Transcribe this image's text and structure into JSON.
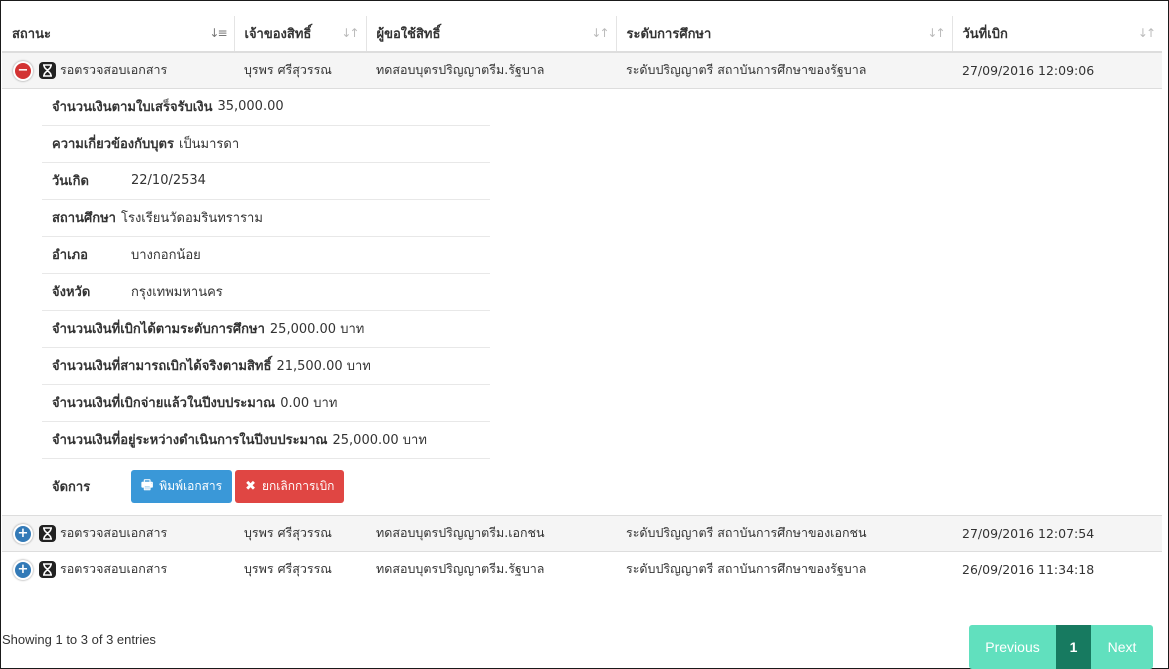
{
  "columns": [
    "สถานะ",
    "เจ้าของสิทธิ์",
    "ผู้ขอใช้สิทธิ์",
    "ระดับการศึกษา",
    "วันที่เบิก"
  ],
  "rows": [
    {
      "status": "รอตรวจสอบเอกสาร",
      "owner": "บุรพร ศรีสุวรรณ",
      "claimant": "ทดสอบบุตรปริญญาตรีม.รัฐบาล",
      "level": "ระดับปริญญาตรี สถาบันการศึกษาของรัฐบาล",
      "date": "27/09/2016 12:09:06"
    },
    {
      "status": "รอตรวจสอบเอกสาร",
      "owner": "บุรพร ศรีสุวรรณ",
      "claimant": "ทดสอบบุตรปริญญาตรีม.เอกชน",
      "level": "ระดับปริญญาตรี สถาบันการศึกษาของเอกชน",
      "date": "27/09/2016 12:07:54"
    },
    {
      "status": "รอตรวจสอบเอกสาร",
      "owner": "บุรพร ศรีสุวรรณ",
      "claimant": "ทดสอบบุตรปริญญาตรีม.รัฐบาล",
      "level": "ระดับปริญญาตรี สถาบันการศึกษาของรัฐบาล",
      "date": "26/09/2016 11:34:18"
    }
  ],
  "detail": {
    "receipt_label": "จำนวนเงินตามใบเสร็จรับเงิน",
    "receipt_value": "35,000.00",
    "relation_label": "ความเกี่ยวข้องกับบุตร",
    "relation_value": "เป็นมารดา",
    "birth_label": "วันเกิด",
    "birth_value": "22/10/2534",
    "school_label": "สถานศึกษา",
    "school_value": "โรงเรียนวัดอมรินทราราม",
    "district_label": "อำเภอ",
    "district_value": "บางกอกน้อย",
    "province_label": "จังหวัด",
    "province_value": "กรุงเทพมหานคร",
    "by_level_label": "จำนวนเงินที่เบิกได้ตามระดับการศึกษา",
    "by_level_value": "25,000.00 บาท",
    "actual_label": "จำนวนเงินที่สามารถเบิกได้จริงตามสิทธิ์",
    "actual_value": "21,500.00 บาท",
    "paid_label": "จำนวนเงินที่เบิกจ่ายแล้วในปีงบประมาณ",
    "paid_value": "0.00 บาท",
    "pending_label": "จำนวนเงินที่อยู่ระหว่างดำเนินการในปีงบประมาณ",
    "pending_value": "25,000.00 บาท",
    "manage_label": "จัดการ",
    "print_label": "พิมพ์เอกสาร",
    "cancel_label": "ยกเลิกการเบิก"
  },
  "footer": {
    "info": "Showing 1 to 3 of 3 entries",
    "previous": "Previous",
    "page": "1",
    "next": "Next"
  },
  "colors": {
    "expand": "#337ab7",
    "collapse": "#d33333",
    "print_button": "#3a98d8",
    "cancel_button": "#e04643",
    "pager": "#61e0be",
    "pager_active": "#177a60"
  }
}
